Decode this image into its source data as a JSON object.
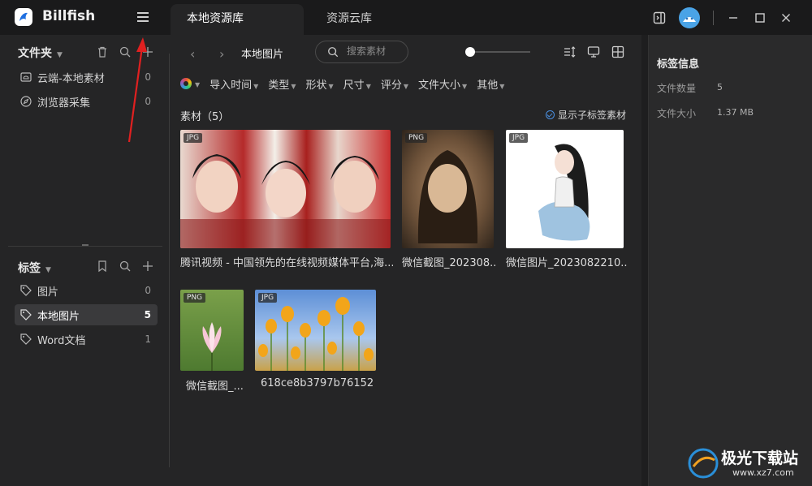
{
  "titlebar": {
    "app_name": "Billfish",
    "tabs": [
      {
        "label": "本地资源库",
        "active": true
      },
      {
        "label": "资源云库",
        "active": false
      }
    ]
  },
  "sidebar": {
    "folders_title": "文件夹",
    "folders": [
      {
        "label": "云端-本地素材",
        "count": "0",
        "icon": "cloud-folder-icon"
      },
      {
        "label": "浏览器采集",
        "count": "0",
        "icon": "compass-icon"
      }
    ],
    "tags_title": "标签",
    "tags": [
      {
        "label": "图片",
        "count": "0",
        "selected": false
      },
      {
        "label": "本地图片",
        "count": "5",
        "selected": true
      },
      {
        "label": "Word文档",
        "count": "1",
        "selected": false
      }
    ]
  },
  "toolbar": {
    "breadcrumb": "本地图片",
    "search_placeholder": "搜索素材",
    "zoom_level": 0.0
  },
  "filters": [
    "导入时间",
    "类型",
    "形状",
    "尺寸",
    "评分",
    "文件大小",
    "其他"
  ],
  "content": {
    "items_title": "素材（5）",
    "show_sub_label": "显示子标签素材",
    "items": [
      {
        "badge": "JPG",
        "label": "腾讯视频 - 中国领先的在线视频媒体平台,海..."
      },
      {
        "badge": "PNG",
        "label": "微信截图_202308..."
      },
      {
        "badge": "JPG",
        "label": "微信图片_2023082210..."
      },
      {
        "badge": "PNG",
        "label": "微信截图_..."
      },
      {
        "badge": "JPG",
        "label": "618ce8b3797b76152"
      }
    ]
  },
  "right_panel": {
    "title": "标签信息",
    "file_count_label": "文件数量",
    "file_count_value": "5",
    "file_size_label": "文件大小",
    "file_size_value": "1.37 MB"
  },
  "watermark": {
    "text": "极光下载站",
    "url": "www.xz7.com"
  },
  "colors": {
    "accent": "#4a90e2",
    "annotation_arrow": "#e02020",
    "background": "#252526"
  }
}
